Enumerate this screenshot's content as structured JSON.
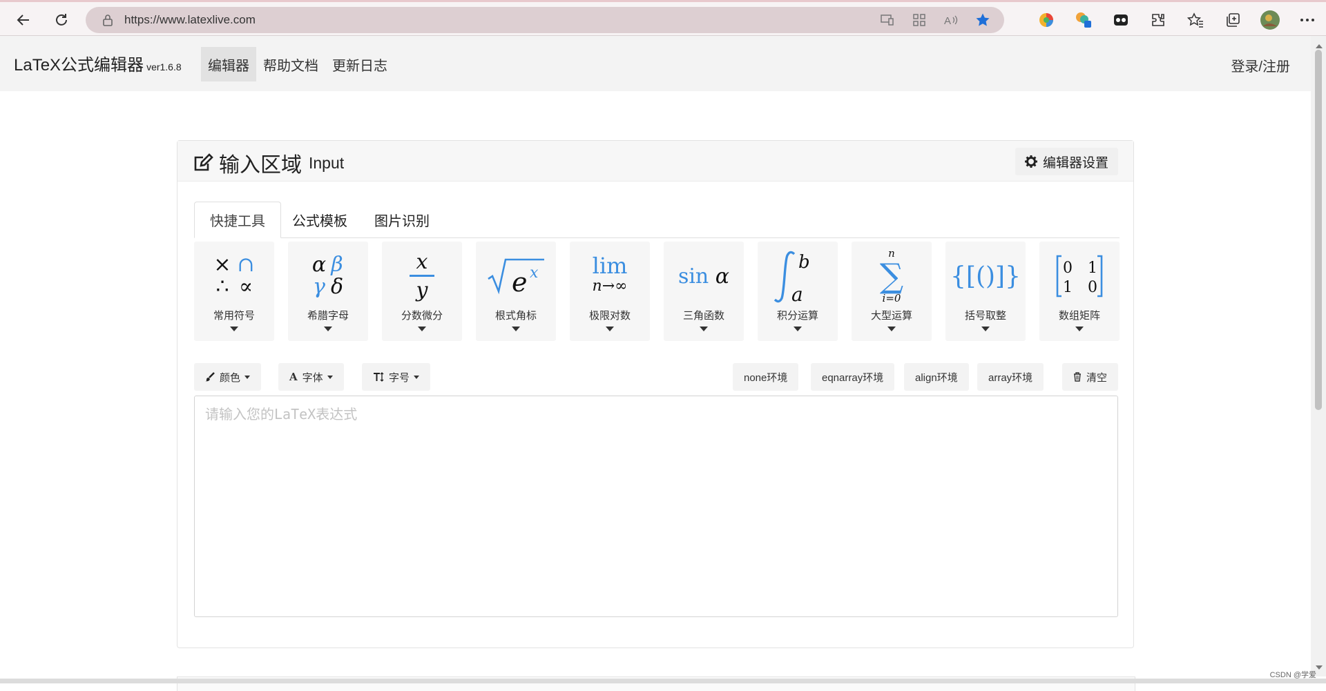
{
  "browser": {
    "url": "https://www.latexlive.com"
  },
  "site": {
    "brand": "LaTeX公式编辑器",
    "version": "ver1.6.8",
    "nav": [
      "编辑器",
      "帮助文档",
      "更新日志"
    ],
    "login": "登录/注册"
  },
  "card": {
    "title": "输入区域",
    "title_en": "Input",
    "settings": "编辑器设置"
  },
  "tabs": [
    "快捷工具",
    "公式模板",
    "图片识别"
  ],
  "tools": [
    {
      "label": "常用符号"
    },
    {
      "label": "希腊字母"
    },
    {
      "label": "分数微分"
    },
    {
      "label": "根式角标"
    },
    {
      "label": "极限对数"
    },
    {
      "label": "三角函数"
    },
    {
      "label": "积分运算"
    },
    {
      "label": "大型运算"
    },
    {
      "label": "括号取整"
    },
    {
      "label": "数组矩阵"
    }
  ],
  "tool_math": {
    "lim": "lim",
    "lim_sub": "n→∞",
    "sin": "sin",
    "alpha": "α",
    "sum": "∑",
    "sum_top": "n",
    "sum_bot": "i=0",
    "brackets": "{[()]}",
    "frac_num": "x",
    "frac_den": "y",
    "int_top": "b",
    "int_bot": "a",
    "e": "e",
    "e_sup": "x",
    "matrix": [
      "0",
      "1",
      "1",
      "0"
    ]
  },
  "format": {
    "color": "颜色",
    "font": "字体",
    "size": "字号",
    "env": [
      "none环境",
      "eqnarray环境",
      "align环境",
      "array环境"
    ],
    "clear": "清空"
  },
  "editor": {
    "placeholder": "请输入您的LaTeX表达式"
  },
  "watermark": "CSDN @学爱",
  "colors": {
    "accent": "#3b8ee0"
  }
}
